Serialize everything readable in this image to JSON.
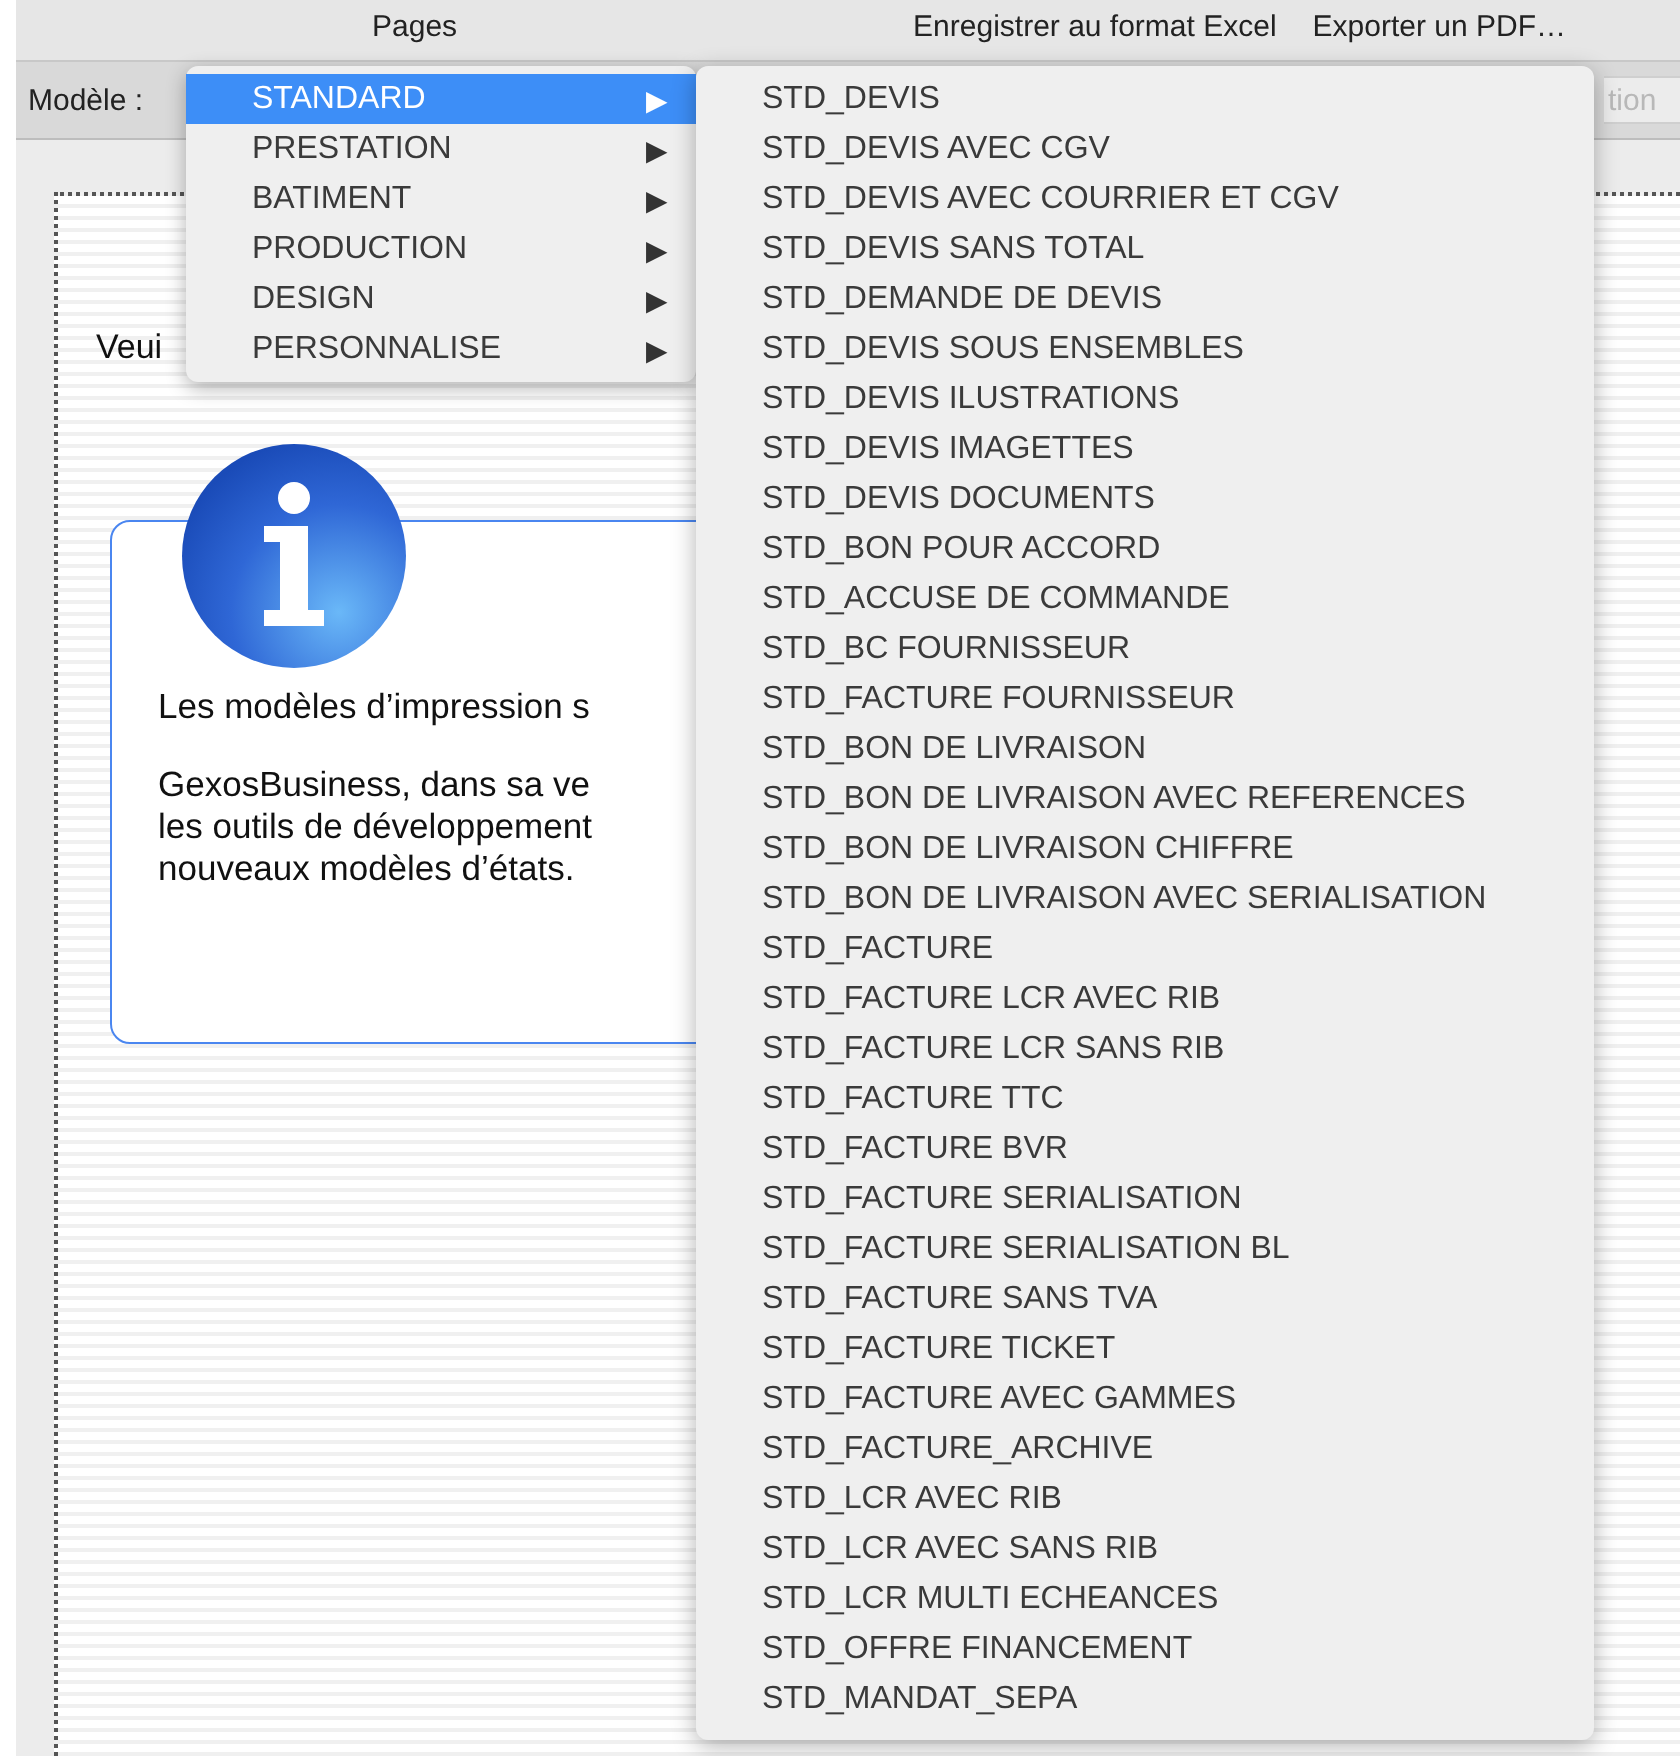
{
  "top_bar": {
    "labels": [
      "Pages",
      "Enregistrer au format Excel",
      "Exporter un PDF…"
    ]
  },
  "toolbar": {
    "label": "Modèle :",
    "right_field_text": "tion"
  },
  "page": {
    "prompt": "Veui",
    "info_card": {
      "paragraphs": [
        "Les modèles d’impression s",
        "GexosBusiness, dans sa ve\nles outils de développement\nnouveaux modèles d’états."
      ]
    }
  },
  "menu": {
    "items": [
      {
        "label": "STANDARD",
        "selected": true,
        "arrow": "▶"
      },
      {
        "label": "PRESTATION",
        "selected": false,
        "arrow": "▶"
      },
      {
        "label": "BATIMENT",
        "selected": false,
        "arrow": "▶"
      },
      {
        "label": "PRODUCTION",
        "selected": false,
        "arrow": "▶"
      },
      {
        "label": "DESIGN",
        "selected": false,
        "arrow": "▶"
      },
      {
        "label": "PERSONNALISE",
        "selected": false,
        "arrow": "▶"
      }
    ]
  },
  "submenu": {
    "items": [
      "STD_DEVIS",
      "STD_DEVIS AVEC CGV",
      "STD_DEVIS AVEC COURRIER ET CGV",
      "STD_DEVIS SANS TOTAL",
      "STD_DEMANDE DE DEVIS",
      "STD_DEVIS SOUS ENSEMBLES",
      "STD_DEVIS ILUSTRATIONS",
      "STD_DEVIS IMAGETTES",
      "STD_DEVIS DOCUMENTS",
      "STD_BON POUR ACCORD",
      "STD_ACCUSE DE COMMANDE",
      "STD_BC FOURNISSEUR",
      "STD_FACTURE FOURNISSEUR",
      "STD_BON DE LIVRAISON",
      "STD_BON DE LIVRAISON AVEC REFERENCES",
      "STD_BON DE LIVRAISON CHIFFRE",
      "STD_BON DE LIVRAISON AVEC SERIALISATION",
      "STD_FACTURE",
      "STD_FACTURE LCR AVEC RIB",
      "STD_FACTURE LCR SANS RIB",
      "STD_FACTURE TTC",
      "STD_FACTURE BVR",
      "STD_FACTURE SERIALISATION",
      "STD_FACTURE SERIALISATION BL",
      "STD_FACTURE SANS TVA",
      "STD_FACTURE TICKET",
      "STD_FACTURE AVEC GAMMES",
      "STD_FACTURE_ARCHIVE",
      "STD_LCR AVEC RIB",
      "STD_LCR AVEC SANS RIB",
      "STD_LCR MULTI ECHEANCES",
      "STD_OFFRE FINANCEMENT",
      "STD_MANDAT_SEPA"
    ]
  }
}
